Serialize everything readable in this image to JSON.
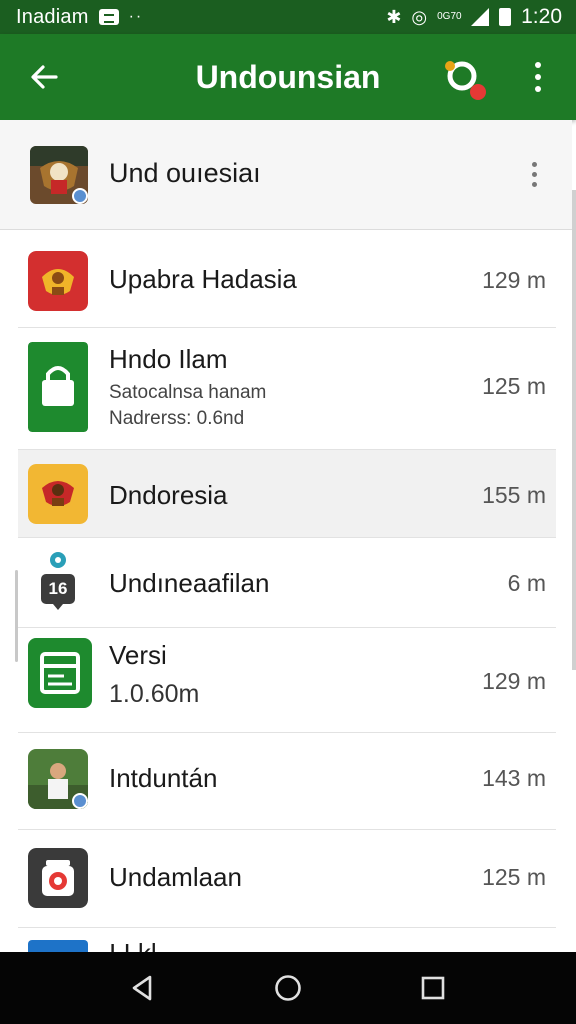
{
  "status_bar": {
    "carrier": "Inadiam",
    "dots": "··",
    "small_text": "0G70",
    "time": "1:20"
  },
  "app_bar": {
    "title": "Undounsian",
    "icons": [
      "back-arrow-icon",
      "search-icon",
      "overflow-menu-icon"
    ]
  },
  "header": {
    "title": "Und ouıesiaı",
    "icon": "emblem-avatar-icon"
  },
  "items": [
    {
      "title": "Upabra Hadasia",
      "size": "129 m",
      "icon": "red-emblem-icon",
      "color": "#d32f2f"
    },
    {
      "title": "Hndo Ilam",
      "sub1": "Satocalnsa hanam",
      "sub2": "Nadrerss: 0.6nd",
      "size": "125 m",
      "icon": "lock-icon",
      "color": "#1e8a2e"
    },
    {
      "title": "Dndoresia",
      "size": "155 m",
      "icon": "yellow-emblem-icon",
      "color": "#f2b733"
    },
    {
      "title": "Undıneaafilan",
      "size": "6 m",
      "icon": "location-badge-icon",
      "badge": "16"
    },
    {
      "title": "Versi",
      "sub1": "1.0.60m",
      "size": "129 m",
      "icon": "document-icon",
      "color": "#1e8a2e"
    },
    {
      "title": "Intduntán",
      "size": "143 m",
      "icon": "photo-avatar-icon"
    },
    {
      "title": "Undamlaan",
      "size": "125 m",
      "icon": "camera-icon",
      "color": "#3a3a3a"
    },
    {
      "title": "I I kl",
      "icon": "blue-app-icon",
      "color": "#1e73c8"
    }
  ],
  "nav_bar": {
    "icons": [
      "back-triangle-icon",
      "home-circle-icon",
      "recents-square-icon"
    ]
  }
}
